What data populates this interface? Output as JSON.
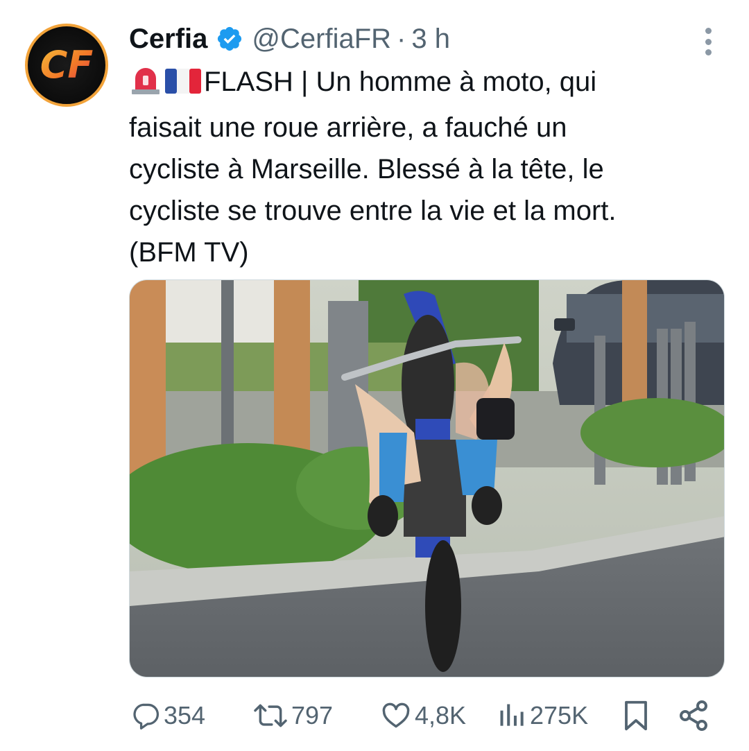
{
  "tweet": {
    "author_name": "Cerfia",
    "handle": "@CerfiaFR",
    "separator": "·",
    "time": "3 h",
    "avatar_logo": "CF",
    "text_lines": [
      "FLASH | Un homme à moto, qui",
      "faisait une roue arrière, a fauché un",
      "cycliste à Marseille. Blessé à la tête, le",
      "cycliste se trouve entre la vie et la mort.",
      "(BFM TV)"
    ],
    "emojis": [
      "rotating-light-emoji",
      "france-flag-emoji"
    ]
  },
  "actions": {
    "replies": "354",
    "retweets": "797",
    "likes": "4,8K",
    "views": "275K"
  },
  "colors": {
    "text": "#0f1419",
    "secondary": "#536471",
    "verified": "#1d9bf0",
    "avatar_ring": "#f2a33a"
  },
  "icons": [
    "verified-badge-icon",
    "more-options-icon",
    "reply-icon",
    "retweet-icon",
    "like-icon",
    "views-icon",
    "bookmark-icon",
    "share-icon"
  ]
}
